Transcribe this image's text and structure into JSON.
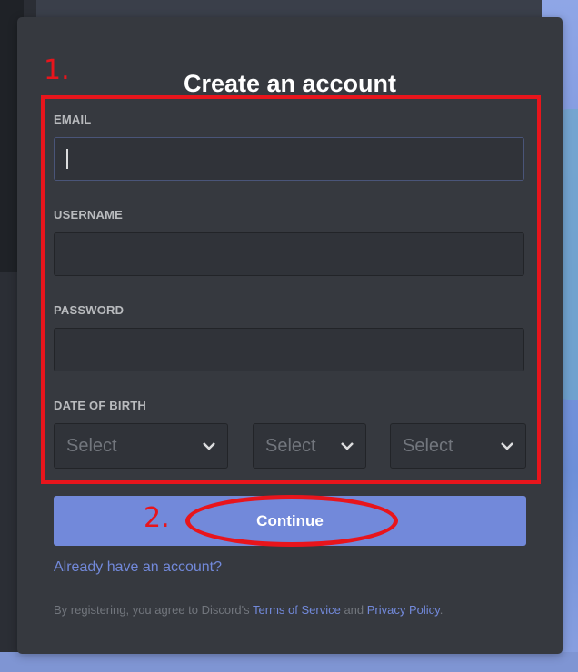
{
  "form": {
    "title": "Create an account",
    "email_label": "EMAIL",
    "email_value": "",
    "username_label": "USERNAME",
    "username_value": "",
    "password_label": "PASSWORD",
    "password_value": "",
    "dob_label": "DATE OF BIRTH",
    "dob_month": "Select",
    "dob_day": "Select",
    "dob_year": "Select",
    "continue_label": "Continue",
    "login_link": "Already have an account?",
    "terms_prefix": "By registering, you agree to Discord's ",
    "terms_link": "Terms of Service",
    "terms_and": " and ",
    "privacy_link": "Privacy Policy",
    "terms_suffix": "."
  },
  "annotations": {
    "step1": "1.",
    "step2": "2."
  },
  "icons": {
    "select_chevron": "chevron-down-icon"
  },
  "colors": {
    "accent": "#7289da",
    "annotation": "#e8151c",
    "card": "#36393f"
  }
}
